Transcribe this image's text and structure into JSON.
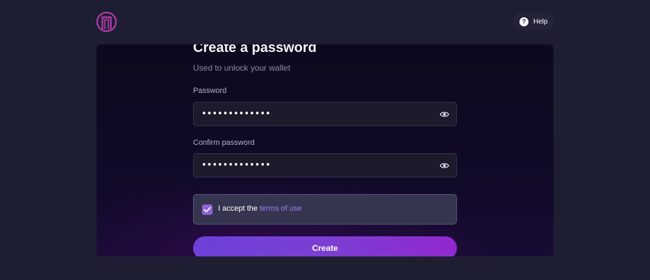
{
  "header": {
    "logo_icon": "gateway-logo-icon",
    "help_icon": "question-mark-icon",
    "help_label": "Help"
  },
  "form": {
    "title": "Create a password",
    "subtitle": "Used to unlock your wallet",
    "password": {
      "label": "Password",
      "value": "•••••••••••••",
      "visibility_icon": "eye-icon"
    },
    "confirm_password": {
      "label": "Confirm password",
      "value": "•••••••••••••",
      "visibility_icon": "eye-icon"
    },
    "terms": {
      "checked": true,
      "prefix": "I accept the",
      "link_text": "terms of use"
    },
    "submit_label": "Create"
  },
  "colors": {
    "background": "#1e1e33",
    "accent": "#8f63d8",
    "link": "#9c7df0",
    "button_gradient_start": "#6d41d8",
    "button_gradient_end": "#9128cf",
    "logo": "#b03aa8"
  }
}
